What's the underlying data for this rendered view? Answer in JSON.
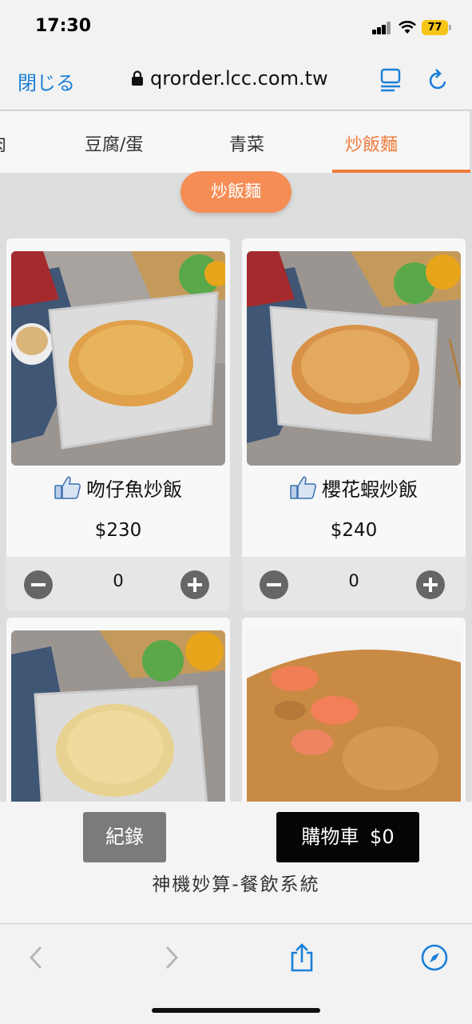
{
  "status_bar": {
    "time": "17:30",
    "battery": "77"
  },
  "browser": {
    "close_label": "閉じる",
    "url": "qrorder.lcc.com.tw"
  },
  "tabs": [
    {
      "label": "肉",
      "active": false
    },
    {
      "label": "豆腐/蛋",
      "active": false
    },
    {
      "label": "青菜",
      "active": false
    },
    {
      "label": "炒飯麵",
      "active": true
    }
  ],
  "section_title": "炒飯麵",
  "products": [
    {
      "name": "吻仔魚炒飯",
      "price": "$230",
      "qty": "0"
    },
    {
      "name": "櫻花蝦炒飯",
      "price": "$240",
      "qty": "0"
    },
    {
      "name": "",
      "price": "",
      "qty": ""
    },
    {
      "name": "",
      "price": "",
      "qty": ""
    }
  ],
  "footer": {
    "history_label": "紀錄",
    "cart_label": "購物車",
    "cart_total": "$0",
    "system_name": "神機妙算-餐飲系統"
  },
  "colors": {
    "accent": "#f07a3a",
    "link": "#1a7fd8",
    "cart": "#050505",
    "history": "#7b7b7b"
  }
}
